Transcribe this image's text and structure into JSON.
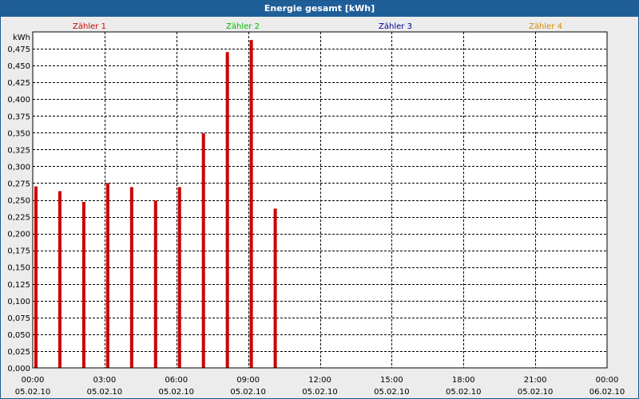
{
  "title": "Energie gesamt [kWh]",
  "chart_data": {
    "type": "bar",
    "title": "Energie gesamt [kWh]",
    "ylabel": "kWh",
    "ylim": [
      0,
      0.5
    ],
    "yticks": [
      "0,000",
      "0,025",
      "0,050",
      "0,075",
      "0,100",
      "0,125",
      "0,150",
      "0,175",
      "0,200",
      "0,225",
      "0,250",
      "0,275",
      "0,300",
      "0,325",
      "0,350",
      "0,375",
      "0,400",
      "0,425",
      "0,450",
      "0,475"
    ],
    "ytick_values": [
      0,
      0.025,
      0.05,
      0.075,
      0.1,
      0.125,
      0.15,
      0.175,
      0.2,
      0.225,
      0.25,
      0.275,
      0.3,
      0.325,
      0.35,
      0.375,
      0.4,
      0.425,
      0.45,
      0.475
    ],
    "xlim_hours": [
      0,
      24
    ],
    "xticks": [
      {
        "time": "00:00",
        "date": "05.02.10",
        "hour": 0
      },
      {
        "time": "03:00",
        "date": "05.02.10",
        "hour": 3
      },
      {
        "time": "06:00",
        "date": "05.02.10",
        "hour": 6
      },
      {
        "time": "09:00",
        "date": "05.02.10",
        "hour": 9
      },
      {
        "time": "12:00",
        "date": "05.02.10",
        "hour": 12
      },
      {
        "time": "15:00",
        "date": "05.02.10",
        "hour": 15
      },
      {
        "time": "18:00",
        "date": "05.02.10",
        "hour": 18
      },
      {
        "time": "21:00",
        "date": "05.02.10",
        "hour": 21
      },
      {
        "time": "00:00",
        "date": "06.02.10",
        "hour": 24
      }
    ],
    "grid": true,
    "legend_position": "top",
    "series": [
      {
        "name": "Zähler 1",
        "color": "#cc0000",
        "hours": [
          0,
          1,
          2,
          3,
          4,
          5,
          6,
          7,
          8,
          9,
          10
        ],
        "values": [
          0.27,
          0.263,
          0.247,
          0.275,
          0.269,
          0.249,
          0.269,
          0.349,
          0.47,
          0.488,
          0.237
        ]
      },
      {
        "name": "Zähler 2",
        "color": "#00bb00",
        "hours": [],
        "values": []
      },
      {
        "name": "Zähler 3",
        "color": "#000099",
        "hours": [],
        "values": []
      },
      {
        "name": "Zähler 4",
        "color": "#dd8800",
        "hours": [],
        "values": []
      }
    ]
  }
}
